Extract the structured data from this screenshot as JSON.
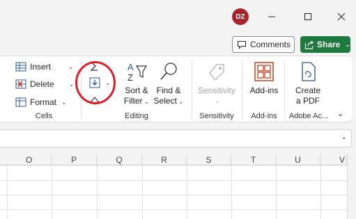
{
  "titlebar": {
    "avatar_initials": "DZ",
    "avatar_color": "#a4262c"
  },
  "actions": {
    "comments_label": "Comments",
    "share_label": "Share",
    "share_color": "#1f7a3f"
  },
  "ribbon": {
    "cells": {
      "label": "Cells",
      "insert_label": "Insert",
      "delete_label": "Delete",
      "format_label": "Format"
    },
    "editing": {
      "label": "Editing",
      "sort_filter_line1": "Sort &",
      "sort_filter_line2": "Filter",
      "find_select_line1": "Find &",
      "find_select_line2": "Select"
    },
    "sensitivity": {
      "label": "Sensitivity",
      "button_label": "Sensitivity"
    },
    "addins": {
      "label": "Add-ins",
      "button_label": "Add-ins"
    },
    "adobe": {
      "label": "Adobe Ac...",
      "line1": "Create",
      "line2": "a PDF"
    },
    "highlight_color": "#e01b24"
  },
  "grid": {
    "columns": [
      "O",
      "P",
      "Q",
      "R",
      "S",
      "T",
      "U",
      "V"
    ]
  }
}
